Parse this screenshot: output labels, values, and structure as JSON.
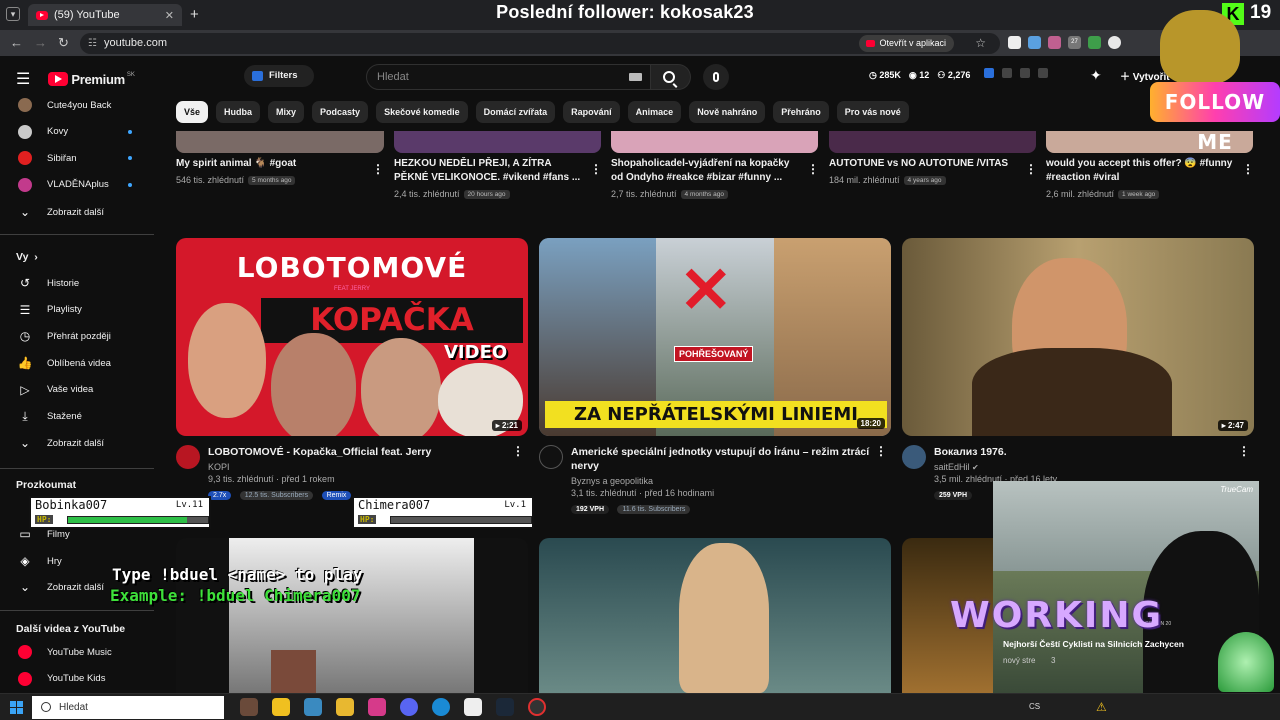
{
  "browser": {
    "tab_title": "(59) YouTube",
    "tab_close": "✕",
    "new_tab": "+",
    "url": "youtube.com",
    "open_in_app": "Otevřít v aplikaci",
    "ext_badge": "27"
  },
  "stream_overlay": {
    "title": "Poslední follower: kokosak23",
    "kick_logo": "K",
    "kick_count": "19",
    "follow_me": "FOLLOW ME",
    "bduel_line1": "Type !bduel <name> to play",
    "bduel_line2": "Example: !bduel Chimera007",
    "working": "WORKING",
    "players": [
      {
        "name": "Bobinka007",
        "level": "Lv.11",
        "hp_label": "HP:",
        "hp": 0.85
      },
      {
        "name": "Chimera007",
        "level": "Lv.1",
        "hp_label": "HP:",
        "hp": 0.0
      }
    ],
    "webcam_brand": "TrueCam",
    "webcam_video_title": "Nejhorší Čeští Cyklisti na Silnicích Zachycen",
    "webcam_video_meta": "nový stre",
    "webcam_video_meta2": "3",
    "webcam_plate": "CITRON 20"
  },
  "header": {
    "logo_text": "Premium",
    "logo_region": "SK",
    "filters_label": "Filters",
    "search_placeholder": "Hledat",
    "stat_views": "285K",
    "stat_watching": "12",
    "stat_subs": "2,276",
    "create_label": "Vytvořit"
  },
  "sidebar": {
    "subscriptions": [
      {
        "label": "Cute4you Back",
        "color": "#8a6a50"
      },
      {
        "label": "Kovy",
        "color": "#c9c9c9"
      },
      {
        "label": "Sibiřan",
        "color": "#e02020"
      },
      {
        "label": "VLADĚNAplus",
        "color": "#c23a8c"
      }
    ],
    "show_more_subs": "Zobrazit další",
    "you_heading": "Vy",
    "you_items": [
      {
        "label": "Historie",
        "icon": "history-icon"
      },
      {
        "label": "Playlisty",
        "icon": "playlist-icon"
      },
      {
        "label": "Přehrát později",
        "icon": "clock-icon"
      },
      {
        "label": "Oblíbená videa",
        "icon": "thumb-up-icon"
      },
      {
        "label": "Vaše videa",
        "icon": "video-icon"
      },
      {
        "label": "Stažené",
        "icon": "download-icon"
      }
    ],
    "show_more_you": "Zobrazit další",
    "explore_heading": "Prozkoumat",
    "explore_items": [
      {
        "label": "Filmy",
        "icon": "film-icon"
      },
      {
        "label": "Hry",
        "icon": "gamepad-icon"
      }
    ],
    "show_more_explore": "Zobrazit další",
    "more_heading": "Další videa z YouTube",
    "more_items": [
      {
        "label": "YouTube Music"
      },
      {
        "label": "YouTube Kids"
      }
    ]
  },
  "chips": [
    "Vše",
    "Hudba",
    "Mixy",
    "Podcasty",
    "Skečové komedie",
    "Domácí zvířata",
    "Rapování",
    "Animace",
    "Nově nahráno",
    "Přehráno",
    "Pro vás nové"
  ],
  "shorts_row": [
    {
      "title": "My spirit animal 🐐 #goat",
      "views": "546 tis. zhlédnutí",
      "age": "5 months ago"
    },
    {
      "title": "HEZKOU NEDĚLI PŘEJI, A ZÍTRA PĚKNÉ VELIKONOCE. #vikend #fans ...",
      "views": "2,4 tis. zhlédnutí",
      "age": "20 hours ago"
    },
    {
      "title": "Shopaholicadel-vyjádření na kopačky od Ondyho #reakce #bizar #funny ...",
      "views": "2,7 tis. zhlédnutí",
      "age": "4 months ago"
    },
    {
      "title": "AUTOTUNE vs NO AUTOTUNE /VITAS",
      "views": "184 mil. zhlédnutí",
      "age": "4 years ago"
    },
    {
      "title": "would you accept this offer? 😨 #funny #reaction #viral",
      "views": "2,6 mil. zhlédnutí",
      "age": "1 week ago"
    }
  ],
  "videos": [
    {
      "title": "LOBOTOMOVÉ - Kopačka_Official feat. Jerry",
      "channel": "KOPI",
      "meta": "9,3 tis. zhlédnutí · před 1 rokem",
      "duration": "2:21",
      "pill1": "2.7x",
      "pill2": "12.5 tis. Subscribers",
      "pill3": "Remix",
      "thumb_title": "LOBOTOMOVÉ",
      "thumb_feat": "FEAT JERRY",
      "thumb_word": "KOPAČKA",
      "thumb_video": "VIDEO"
    },
    {
      "title": "Americké speciální jednotky vstupují do Íránu – režim ztrácí nervy",
      "channel": "Byznys a geopolitika",
      "meta": "3,1 tis. zhlédnutí · před 16 hodinami",
      "duration": "18:20",
      "pill1": "192 VPH",
      "pill2": "11.6 tis. Subscribers",
      "thumb_caption": "ZA NEPŘÁTELSKÝMI LINIEMI",
      "thumb_tag": "POHŘEŠOVANÝ"
    },
    {
      "title": "Вокализ 1976.",
      "channel": "saitEdHil",
      "meta": "3,5 mil. zhlédnutí · před 16 lety",
      "duration": "2:47",
      "pill1": "259 VPH"
    }
  ],
  "taskbar": {
    "search_label": "Hledat",
    "lang": "CS"
  }
}
